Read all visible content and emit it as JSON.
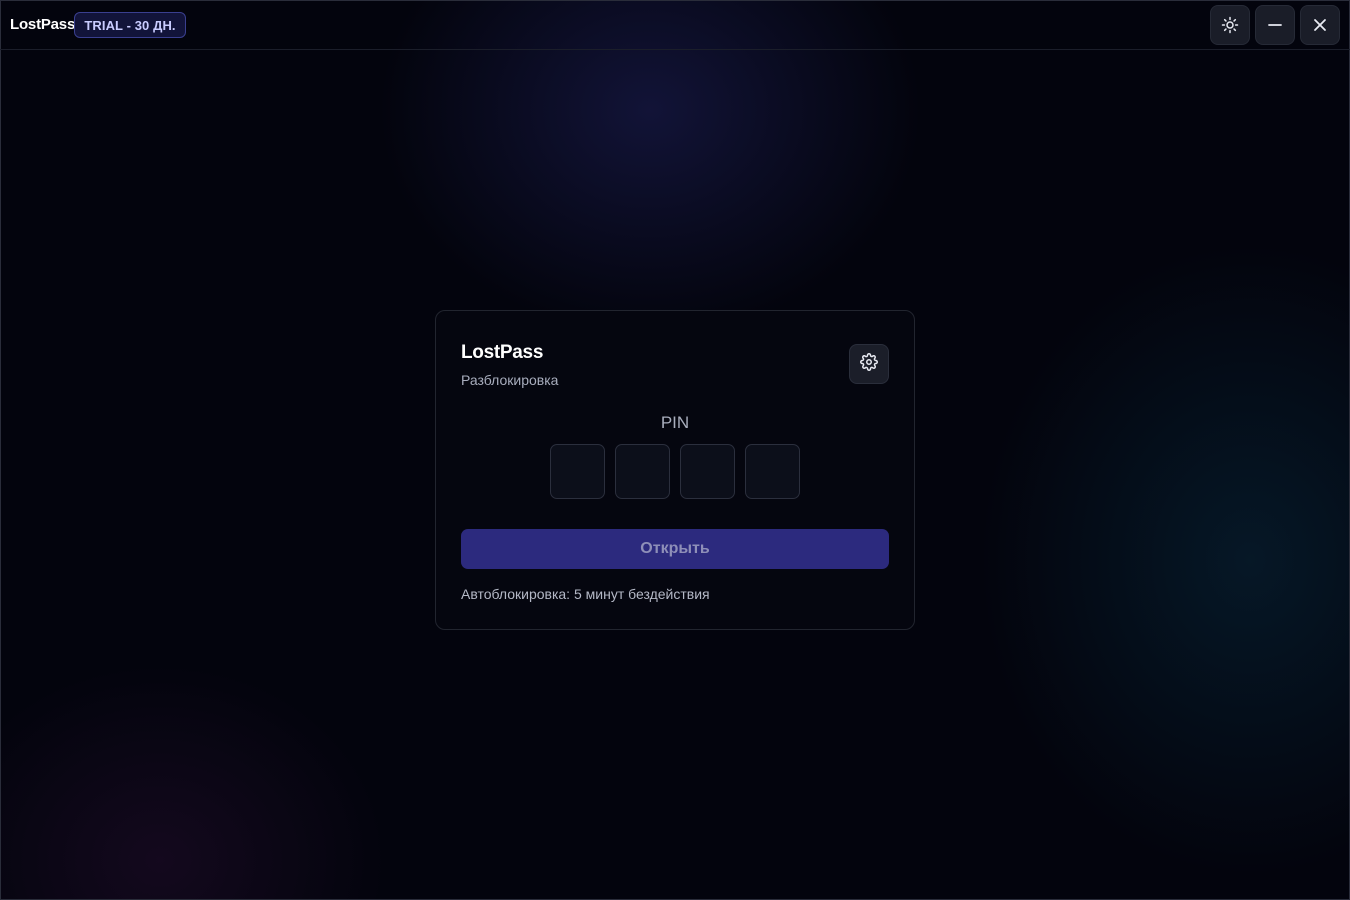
{
  "window": {
    "app_name": "LostPass",
    "trial_badge": "TRIAL - 30 ДН.",
    "controls": {
      "theme_icon": "sun-icon",
      "minimize_icon": "minimize-icon",
      "close_icon": "close-icon"
    }
  },
  "lock_card": {
    "title": "LostPass",
    "subtitle": "Разблокировка",
    "settings_icon": "gear-icon",
    "pin_label": "PIN",
    "pin_digits": [
      "",
      "",
      "",
      ""
    ],
    "open_button_label": "Открыть",
    "autolock_text": "Автоблокировка: 5 минут бездействия"
  },
  "colors": {
    "accent": "#2c2a7e",
    "badge_border": "#3a3f8f",
    "background": "#03040d"
  }
}
